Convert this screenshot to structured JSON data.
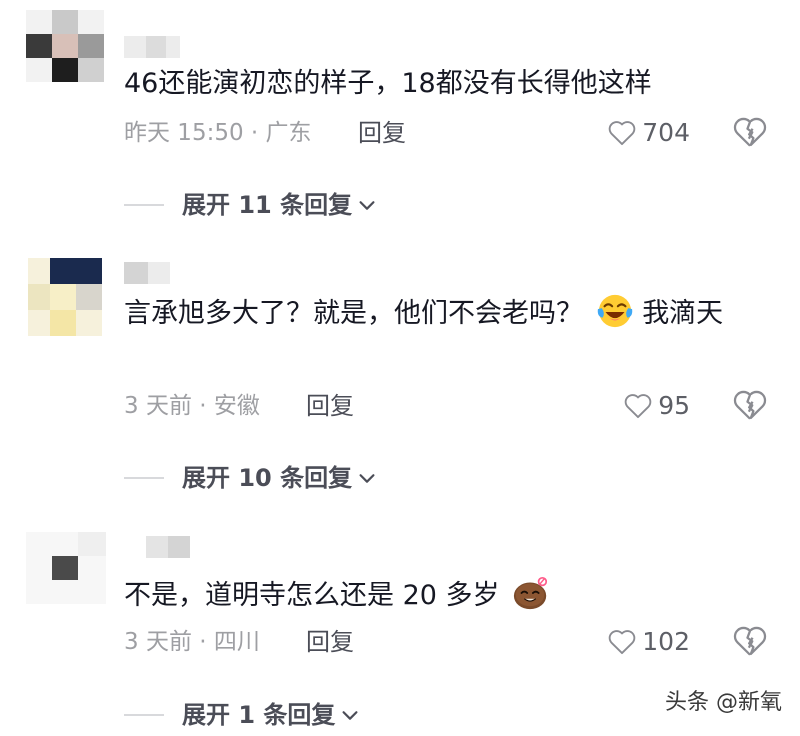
{
  "comments": [
    {
      "text": "46还能演初恋的样子，18都没有长得他这样",
      "meta": "昨天 15:50 · 广东",
      "reply_label": "回复",
      "likes": "704",
      "expand_label": "展开 11 条回复"
    },
    {
      "text": "言承旭多大了？就是，他们不会老吗？",
      "text_tail": "我滴天",
      "emoji": "laughing-crying-emoji",
      "meta": "3 天前 · 安徽",
      "reply_label": "回复",
      "likes": "95",
      "expand_label": "展开 10 条回复"
    },
    {
      "text": "不是，道明寺怎么还是 20 多岁",
      "emoji": "shy-potato-emoji",
      "meta": "3 天前 · 四川",
      "reply_label": "回复",
      "likes": "102",
      "expand_label": "展开 1 条回复"
    }
  ],
  "watermark": "头条 @新氧",
  "colors": {
    "text": "#161823",
    "meta": "#9e9fa3",
    "action": "#4b4d57"
  },
  "icons": [
    "heart-outline-icon",
    "broken-heart-icon",
    "chevron-down-icon"
  ]
}
